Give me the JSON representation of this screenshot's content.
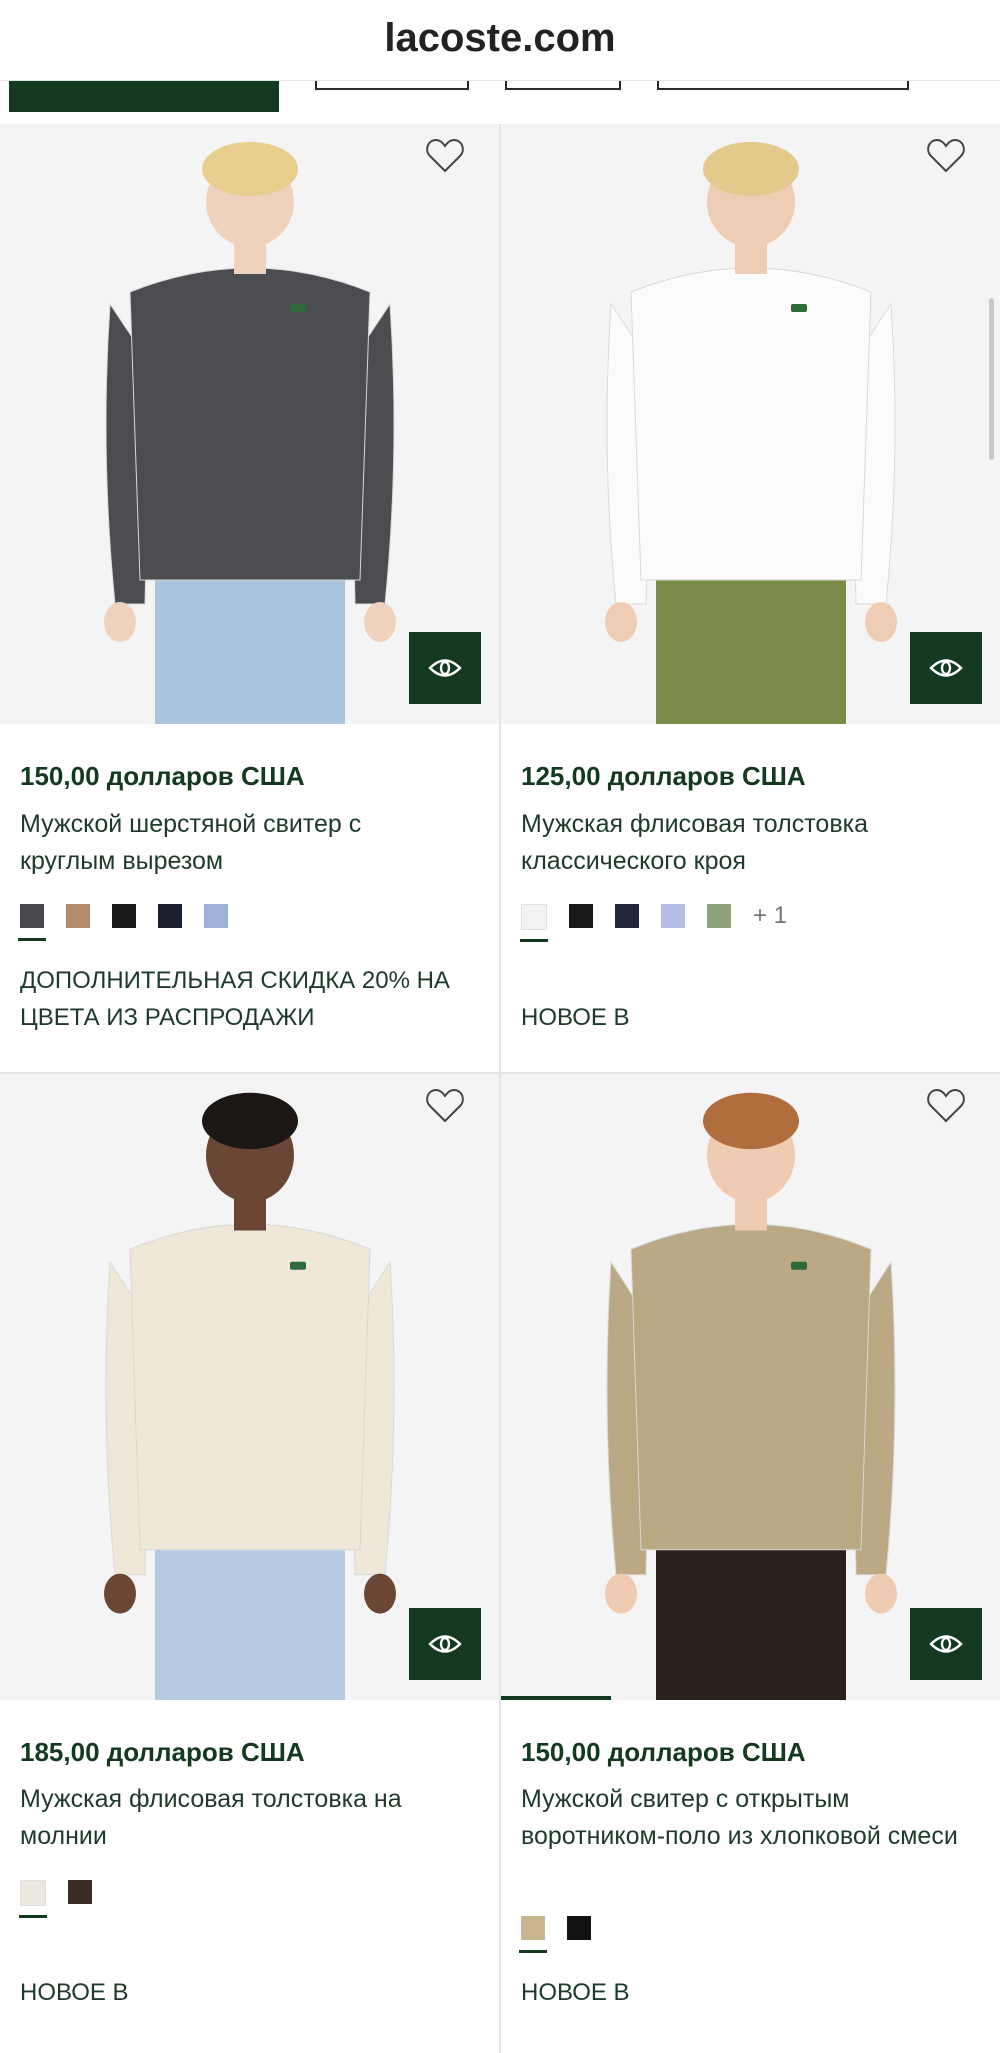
{
  "browser": {
    "url": "lacoste.com"
  },
  "products": [
    {
      "price": "150,00 долларов США",
      "name": "Мужской шерстяной свитер с круглым вырезом",
      "swatches": [
        "#4a4a4e",
        "#b48d6e",
        "#1a1a1a",
        "#1c1f30",
        "#9fb2d9"
      ],
      "more": "",
      "promo": "ДОПОЛНИТЕЛЬНАЯ СКИДКА 20% НА ЦВЕТА ИЗ РАСПРОДАЖИ",
      "shirt_color": "#4b4c50",
      "pants_color": "#a9c4dc",
      "hair_color": "#e8cf8e",
      "skin_color": "#efd2bd"
    },
    {
      "price": "125,00 долларов США",
      "name": "Мужская флисовая толстовка классического кроя",
      "swatches": [
        "#f2f2f2",
        "#1a1a1a",
        "#20253b",
        "#b6bde6",
        "#8ea37c"
      ],
      "more": "+ 1",
      "promo": "НОВОЕ В",
      "shirt_color": "#fbfbfb",
      "pants_color": "#7b8b4a",
      "hair_color": "#e3c98c",
      "skin_color": "#efcdb5"
    },
    {
      "price": "185,00 долларов США",
      "name": "Мужская флисовая толстовка на молнии",
      "swatches": [
        "#ece9e1",
        "#3a2d28"
      ],
      "more": "",
      "promo": "НОВОЕ В",
      "shirt_color": "#efe8d8",
      "pants_color": "#b5cbe1",
      "hair_color": "#1c1714",
      "skin_color": "#6b4634"
    },
    {
      "price": "150,00 долларов США",
      "name": "Мужской свитер с открытым воротником-поло из хлопковой смеси",
      "swatches": [
        "#c9b58f",
        "#111111"
      ],
      "more": "",
      "promo": "НОВОЕ В",
      "shirt_color": "#bba884",
      "pants_color": "#2a211d",
      "hair_color": "#b06d3d",
      "skin_color": "#efcbb2",
      "image_progress": 0.22
    }
  ],
  "colors": {
    "brand_green": "#13391f"
  },
  "icons": {
    "wishlist": "heart-icon",
    "quick_view": "eye-icon"
  }
}
